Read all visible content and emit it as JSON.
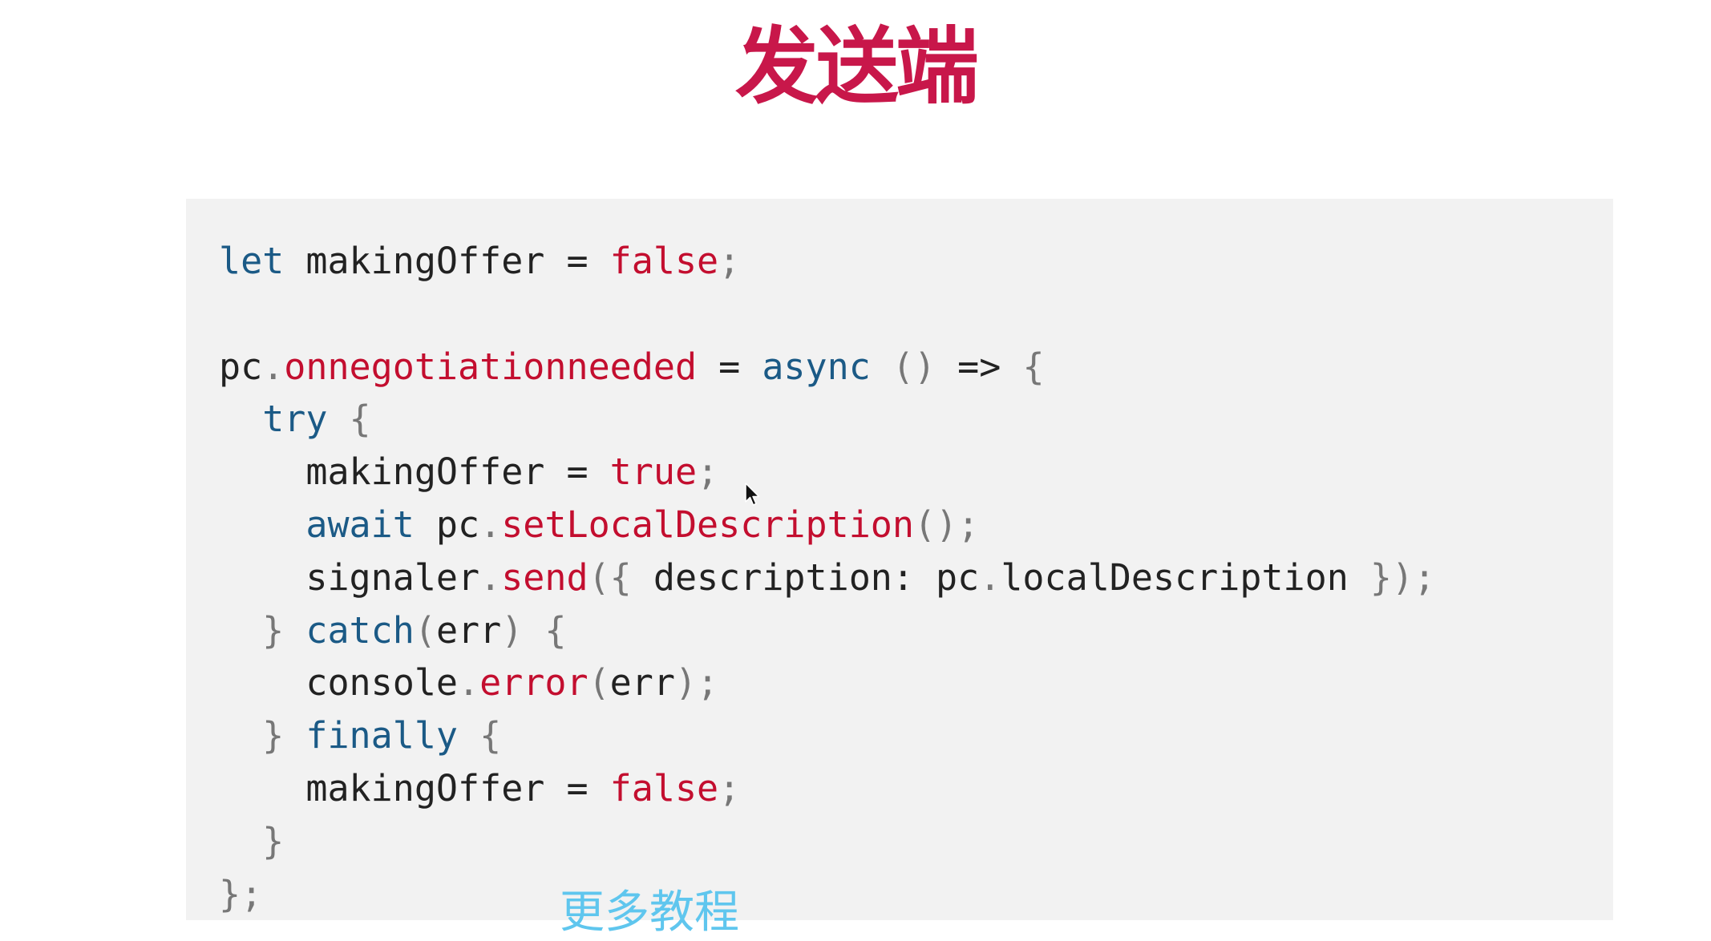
{
  "slide": {
    "title": "发送端"
  },
  "code_lines": [
    [
      {
        "t": "let",
        "c": "kw"
      },
      {
        "t": " makingOffer = ",
        "c": "txt"
      },
      {
        "t": "false",
        "c": "prop"
      },
      {
        "t": ";",
        "c": "pun"
      }
    ],
    [],
    [
      {
        "t": "pc",
        "c": "txt"
      },
      {
        "t": ".",
        "c": "pun"
      },
      {
        "t": "onnegotiationneeded",
        "c": "prop"
      },
      {
        "t": " = ",
        "c": "txt"
      },
      {
        "t": "async",
        "c": "kw"
      },
      {
        "t": " () ",
        "c": "pun"
      },
      {
        "t": "=>",
        "c": "txt"
      },
      {
        "t": " {",
        "c": "pun"
      }
    ],
    [
      {
        "t": "  ",
        "c": "txt"
      },
      {
        "t": "try",
        "c": "kw"
      },
      {
        "t": " {",
        "c": "pun"
      }
    ],
    [
      {
        "t": "    makingOffer = ",
        "c": "txt"
      },
      {
        "t": "true",
        "c": "prop"
      },
      {
        "t": ";",
        "c": "pun"
      }
    ],
    [
      {
        "t": "    ",
        "c": "txt"
      },
      {
        "t": "await",
        "c": "kw"
      },
      {
        "t": " pc",
        "c": "txt"
      },
      {
        "t": ".",
        "c": "pun"
      },
      {
        "t": "setLocalDescription",
        "c": "prop"
      },
      {
        "t": "();",
        "c": "pun"
      }
    ],
    [
      {
        "t": "    signaler",
        "c": "txt"
      },
      {
        "t": ".",
        "c": "pun"
      },
      {
        "t": "send",
        "c": "prop"
      },
      {
        "t": "({ ",
        "c": "pun"
      },
      {
        "t": "description: pc",
        "c": "txt"
      },
      {
        "t": ".",
        "c": "pun"
      },
      {
        "t": "localDescription",
        "c": "txt"
      },
      {
        "t": " });",
        "c": "pun"
      }
    ],
    [
      {
        "t": "  } ",
        "c": "pun"
      },
      {
        "t": "catch",
        "c": "kw"
      },
      {
        "t": "(",
        "c": "pun"
      },
      {
        "t": "err",
        "c": "txt"
      },
      {
        "t": ") {",
        "c": "pun"
      }
    ],
    [
      {
        "t": "    console",
        "c": "txt"
      },
      {
        "t": ".",
        "c": "pun"
      },
      {
        "t": "error",
        "c": "prop"
      },
      {
        "t": "(",
        "c": "pun"
      },
      {
        "t": "err",
        "c": "txt"
      },
      {
        "t": ");",
        "c": "pun"
      }
    ],
    [
      {
        "t": "  } ",
        "c": "pun"
      },
      {
        "t": "finally",
        "c": "kw"
      },
      {
        "t": " {",
        "c": "pun"
      }
    ],
    [
      {
        "t": "    makingOffer = ",
        "c": "txt"
      },
      {
        "t": "false",
        "c": "prop"
      },
      {
        "t": ";",
        "c": "pun"
      }
    ],
    [
      {
        "t": "  }",
        "c": "pun"
      }
    ],
    [
      {
        "t": "};",
        "c": "pun"
      }
    ]
  ],
  "subtitle": {
    "text": "更多教程"
  },
  "colors": {
    "title": "#c8174a",
    "keyword": "#1b5a86",
    "property": "#c30e2f",
    "text": "#222222",
    "punctuation": "#777777",
    "code_background": "#f2f2f2",
    "subtitle": "#5fc6ee"
  },
  "icons": {
    "cursor": "mouse-pointer-icon"
  }
}
